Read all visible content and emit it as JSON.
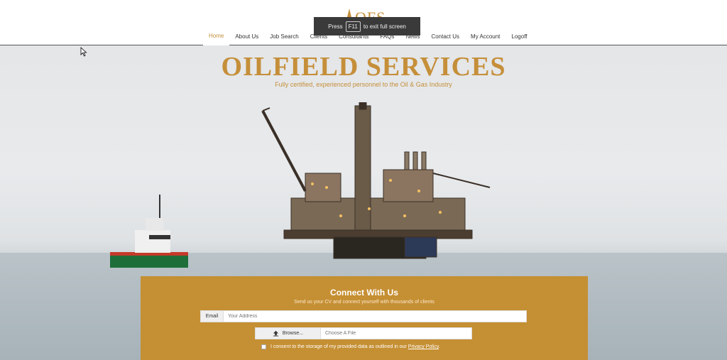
{
  "header": {
    "logo_text": "OFS",
    "nav": [
      {
        "label": "Home"
      },
      {
        "label": "About Us"
      },
      {
        "label": "Job Search"
      },
      {
        "label": "Clients"
      },
      {
        "label": "Consultants"
      },
      {
        "label": "FAQs"
      },
      {
        "label": "News"
      },
      {
        "label": "Contact Us"
      },
      {
        "label": "My Account"
      },
      {
        "label": "Logoff"
      }
    ]
  },
  "toast": {
    "prefix": "Press",
    "key": "F11",
    "suffix": "to exit full screen"
  },
  "hero": {
    "title": "OILFIELD SERVICES",
    "subtitle": "Fully certified, experienced personnel to the Oil & Gas Industry"
  },
  "connect": {
    "title": "Connect With Us",
    "subtitle": "Send us your CV and connect yourself with thousands of clients",
    "email_label": "Email",
    "email_placeholder": "Your Address",
    "browse_label": "Browse...",
    "file_placeholder": "Choose A File",
    "consent_text": "I consent to the storage of my provided data as outlined in our",
    "privacy_link": "Privacy Policy",
    "consent_end": "."
  },
  "colors": {
    "accent": "#c58f3a",
    "panel": "#c58f33"
  }
}
